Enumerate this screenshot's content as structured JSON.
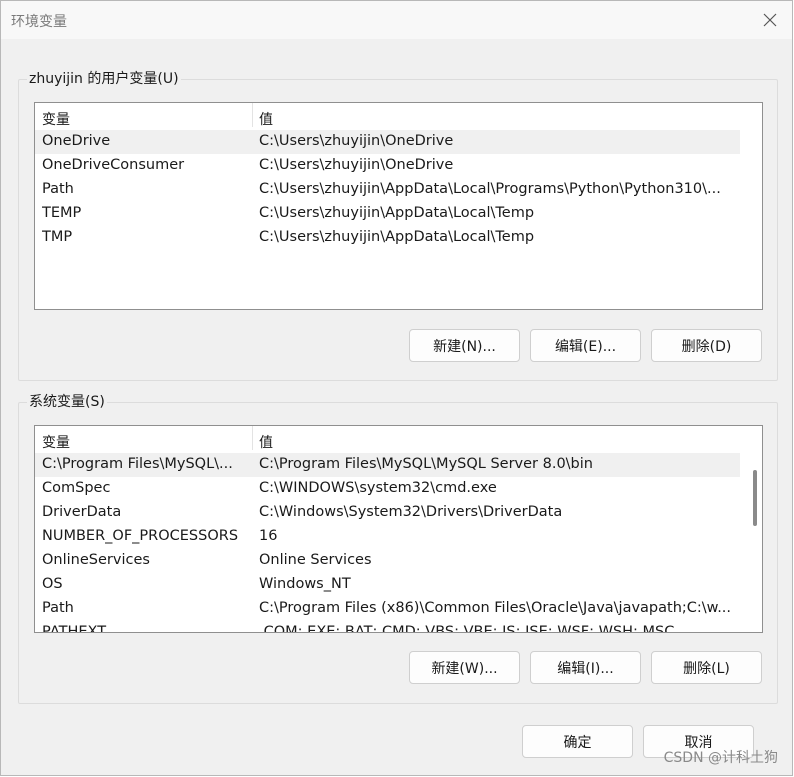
{
  "window": {
    "title": "环境变量"
  },
  "user_vars": {
    "label": "zhuyijin 的用户变量(U)",
    "columns": {
      "name": "变量",
      "value": "值"
    },
    "rows": [
      {
        "name": "OneDrive",
        "value": "C:\\Users\\zhuyijin\\OneDrive"
      },
      {
        "name": "OneDriveConsumer",
        "value": "C:\\Users\\zhuyijin\\OneDrive"
      },
      {
        "name": "Path",
        "value": "C:\\Users\\zhuyijin\\AppData\\Local\\Programs\\Python\\Python310\\..."
      },
      {
        "name": "TEMP",
        "value": "C:\\Users\\zhuyijin\\AppData\\Local\\Temp"
      },
      {
        "name": "TMP",
        "value": "C:\\Users\\zhuyijin\\AppData\\Local\\Temp"
      }
    ],
    "buttons": {
      "new": "新建(N)...",
      "edit": "编辑(E)...",
      "delete": "删除(D)"
    }
  },
  "system_vars": {
    "label": "系统变量(S)",
    "columns": {
      "name": "变量",
      "value": "值"
    },
    "rows": [
      {
        "name": "C:\\Program Files\\MySQL\\...",
        "value": "C:\\Program Files\\MySQL\\MySQL Server 8.0\\bin"
      },
      {
        "name": "ComSpec",
        "value": "C:\\WINDOWS\\system32\\cmd.exe"
      },
      {
        "name": "DriverData",
        "value": "C:\\Windows\\System32\\Drivers\\DriverData"
      },
      {
        "name": "NUMBER_OF_PROCESSORS",
        "value": "16"
      },
      {
        "name": "OnlineServices",
        "value": "Online Services"
      },
      {
        "name": "OS",
        "value": "Windows_NT"
      },
      {
        "name": "Path",
        "value": "C:\\Program Files (x86)\\Common Files\\Oracle\\Java\\javapath;C:\\w..."
      },
      {
        "name": "PATHEXT",
        "value": ".COM;.EXE;.BAT;.CMD;.VBS;.VBE;.JS;.JSE;.WSF;.WSH;.MSC"
      }
    ],
    "buttons": {
      "new": "新建(W)...",
      "edit": "编辑(I)...",
      "delete": "删除(L)"
    }
  },
  "footer": {
    "ok": "确定",
    "cancel": "取消"
  },
  "watermark": "CSDN @计科土狗"
}
